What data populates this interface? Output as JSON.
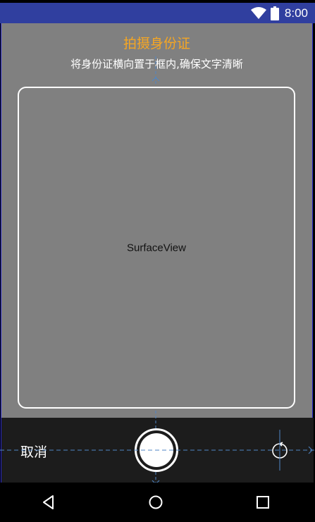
{
  "status_bar": {
    "time": "8:00",
    "icons": [
      "wifi-icon",
      "battery-icon"
    ],
    "color": "#303f9f"
  },
  "header": {
    "title": "拍摄身份证",
    "subtitle": "将身份证横向置于框内,确保文字清晰",
    "title_color": "#f5a623"
  },
  "preview": {
    "label": "SurfaceView",
    "background": "#808080"
  },
  "controls": {
    "cancel_label": "取消",
    "shutter_icon": "shutter-icon",
    "switch_icon": "switch-camera-icon"
  },
  "nav_bar": {
    "buttons": [
      "back-icon",
      "home-icon",
      "recents-icon"
    ]
  }
}
